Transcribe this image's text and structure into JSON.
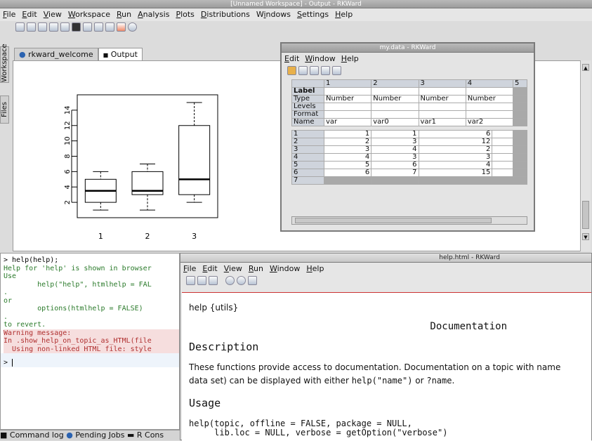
{
  "main": {
    "title": "[Unnamed Workspace] - Output - RKWard",
    "menu": [
      "File",
      "Edit",
      "View",
      "Workspace",
      "Run",
      "Analysis",
      "Plots",
      "Distributions",
      "Windows",
      "Settings",
      "Help"
    ],
    "toolbar_icons": [
      "new-script-icon",
      "new-data-icon",
      "open-icon",
      "save-icon",
      "window-icon",
      "stop-icon",
      "zoom-icon",
      "zoom-in-icon",
      "zoom-out-icon",
      "close-icon",
      "refresh-icon"
    ],
    "tabs": [
      "rkward_welcome",
      "Output"
    ],
    "side_tabs": [
      "Workspace",
      "Files"
    ],
    "bottom_tabs": [
      "Command log",
      "Pending Jobs",
      "R Cons"
    ]
  },
  "chart_data": {
    "type": "boxplot",
    "categories": [
      "1",
      "2",
      "3"
    ],
    "boxes": [
      {
        "min": 1,
        "q1": 2,
        "median": 3.5,
        "q3": 5,
        "max": 6
      },
      {
        "min": 1,
        "q1": 3,
        "median": 3.5,
        "q3": 6,
        "max": 7
      },
      {
        "min": 2,
        "q1": 3,
        "median": 5,
        "q3": 12,
        "max": 15
      }
    ],
    "yticks": [
      "2",
      "4",
      "6",
      "8",
      "10",
      "12",
      "14"
    ],
    "ylim": [
      0,
      16
    ]
  },
  "data_editor": {
    "title": "my.data - RKWard",
    "menu": [
      "Edit",
      "Window",
      "Help"
    ],
    "col_headers": [
      "1",
      "2",
      "3",
      "4",
      "5"
    ],
    "meta_rows": [
      {
        "label": "Label",
        "cells": [
          "",
          "",
          "",
          ""
        ]
      },
      {
        "label": "Type",
        "cells": [
          "Number",
          "Number",
          "Number",
          "Number"
        ]
      },
      {
        "label": "Levels",
        "cells": [
          "",
          "",
          "",
          ""
        ]
      },
      {
        "label": "Format",
        "cells": [
          "",
          "",
          "",
          ""
        ]
      },
      {
        "label": "Name",
        "cells": [
          "var",
          "var0",
          "var1",
          "var2"
        ]
      }
    ],
    "rows": [
      {
        "n": "1",
        "v": [
          "1",
          "1",
          "6",
          ""
        ]
      },
      {
        "n": "2",
        "v": [
          "2",
          "3",
          "12",
          ""
        ]
      },
      {
        "n": "3",
        "v": [
          "3",
          "4",
          "2",
          ""
        ]
      },
      {
        "n": "4",
        "v": [
          "4",
          "3",
          "3",
          ""
        ]
      },
      {
        "n": "5",
        "v": [
          "5",
          "6",
          "4",
          ""
        ]
      },
      {
        "n": "6",
        "v": [
          "6",
          "7",
          "15",
          ""
        ]
      },
      {
        "n": "7",
        "v": [
          "",
          "",
          "",
          ""
        ]
      }
    ]
  },
  "console": {
    "lines": [
      {
        "t": "> help(help);",
        "c": "#000",
        "bg": "#fff"
      },
      {
        "t": "Help for 'help' is shown in browser",
        "c": "#2a7a2a",
        "bg": "#fff"
      },
      {
        "t": "Use",
        "c": "#2a7a2a",
        "bg": "#fff"
      },
      {
        "t": "        help(\"help\", htmlhelp = FAL",
        "c": "#2a7a2a",
        "bg": "#fff"
      },
      {
        "t": ".",
        "c": "#2a7a2a",
        "bg": "#fff"
      },
      {
        "t": "or",
        "c": "#2a7a2a",
        "bg": "#fff"
      },
      {
        "t": "        options(htmlhelp = FALSE)",
        "c": "#2a7a2a",
        "bg": "#fff"
      },
      {
        "t": ".",
        "c": "#2a7a2a",
        "bg": "#fff"
      },
      {
        "t": "to revert.",
        "c": "#2a7a2a",
        "bg": "#fff"
      },
      {
        "t": "Warning message:",
        "c": "#b03030",
        "bg": "#f6dede"
      },
      {
        "t": "In .show_help_on_topic_as_HTML(file",
        "c": "#b03030",
        "bg": "#f6dede"
      },
      {
        "t": "  Using non-linked HTML file: style",
        "c": "#b03030",
        "bg": "#f6dede"
      }
    ],
    "prompt": ">"
  },
  "help": {
    "title": "help.html - RKWard",
    "menu": [
      "File",
      "Edit",
      "View",
      "Run",
      "Window",
      "Help"
    ],
    "topic": "help {utils}",
    "heading": "Documentation",
    "section1": "Description",
    "para1_a": "These functions provide access to documentation. Documentation on a topic with name",
    "para1_b_pre": "data set) can be displayed with either ",
    "para1_code1": "help(\"name\")",
    "para1_or": " or ",
    "para1_code2": "?name",
    "para1_end": ".",
    "section2": "Usage",
    "usage1": "help(topic, offline = FALSE, package = NULL,",
    "usage2": "     lib.loc = NULL, verbose = getOption(\"verbose\")"
  }
}
